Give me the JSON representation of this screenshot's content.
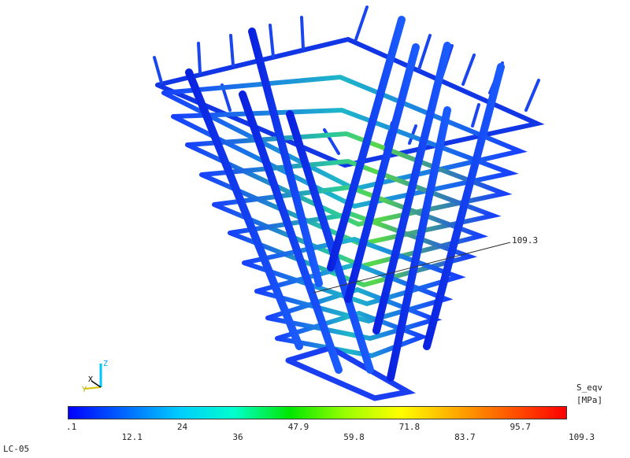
{
  "model": {
    "max_callout": "109.3",
    "max_value": 109.3
  },
  "triad": {
    "z_label": "Z",
    "x_label": "X",
    "y_label": "Y"
  },
  "legend": {
    "title": "S_eqv",
    "unit": "[MPa]",
    "min": 0.1,
    "max": 109.3,
    "tick_labels": [
      ".1",
      "12.1",
      "24",
      "36",
      "47.9",
      "59.8",
      "71.8",
      "83.7",
      "95.7",
      "109.3"
    ],
    "colors": [
      "#0000ff",
      "#0066ff",
      "#00ccff",
      "#00ffcc",
      "#00e600",
      "#99ff00",
      "#ffff00",
      "#ffaa00",
      "#ff5500",
      "#ff0000"
    ]
  },
  "load_case": "LC-05"
}
